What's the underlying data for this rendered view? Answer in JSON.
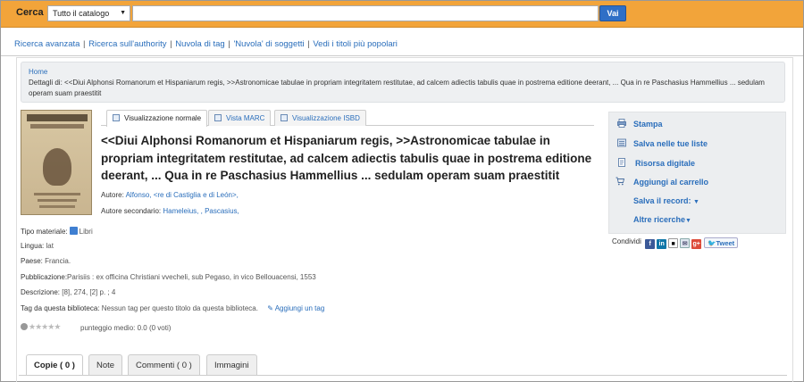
{
  "search": {
    "label": "Cerca",
    "scope": "Tutto il catalogo",
    "query": "",
    "placeholder": "",
    "button": "Vai"
  },
  "toplinks": [
    "Ricerca avanzata",
    "Ricerca sull'authority",
    "Nuvola di tag",
    "'Nuvola' di soggetti",
    "Vedi i titoli più popolari"
  ],
  "breadcrumb": {
    "home": "Home",
    "detail": "Dettagli di: <<Diui Alphonsi Romanorum et Hispaniarum regis, >>Astronomicae tabulae in propriam integritatem restitutae, ad calcem adiectis tabulis quae in postrema editione deerant, ... Qua in re Paschasius Hammellius ... sedulam operam suam praestitit"
  },
  "view_tabs": [
    "Visualizzazione normale",
    "Vista MARC",
    "Visualizzazione ISBD"
  ],
  "record": {
    "title": "<<Diui Alphonsi Romanorum et Hispaniarum regis, >>Astronomicae tabulae in propriam integritatem restitutae, ad calcem adiectis tabulis quae in postrema editione deerant, ... Qua in re Paschasius Hammellius ... sedulam operam suam praestitit",
    "author_label": "Autore:",
    "author": "Alfonso, <re di Castiglia e di León>,",
    "secondary_label": "Autore secondario:",
    "secondary": "Hameleius, , Pascasius,",
    "material_label": "Tipo materiale:",
    "material": "Libri",
    "language_label": "Lingua:",
    "language": "lat",
    "country_label": "Paese:",
    "country": "Francia.",
    "publication_label": "Pubblicazione:",
    "publication": "Parisiis : ex officina Christiani vvecheli, sub Pegaso, in vico Bellouacensi, 1553",
    "description_label": "Descrizione:",
    "description": "[8], 274, [2] p. ; 4",
    "tags_label": "Tag da questa biblioteca:",
    "tags": "Nessun tag per questo titolo da questa biblioteca.",
    "add_tag": "Aggiungi un tag",
    "rating": "punteggio medio: 0.0 (0 voti)",
    "rating_value": 0,
    "rating_max": 5
  },
  "actions": {
    "print": "Stampa",
    "save_list": "Salva nelle tue liste",
    "digital": "Risorsa digitale",
    "cart": "Aggiungi al carrello",
    "save_record": "Salva il record:",
    "more_searches": "Altre ricerche"
  },
  "share": {
    "label": "Condividi",
    "tweet": "Tweet"
  },
  "bottom_tabs": [
    "Copie ( 0 )",
    "Note",
    "Commenti ( 0 )",
    "Immagini"
  ],
  "colors": {
    "searchbar": "#f2a43a",
    "button": "#2f6fc6",
    "link": "#2a6ebb",
    "panel": "#eceef0"
  }
}
